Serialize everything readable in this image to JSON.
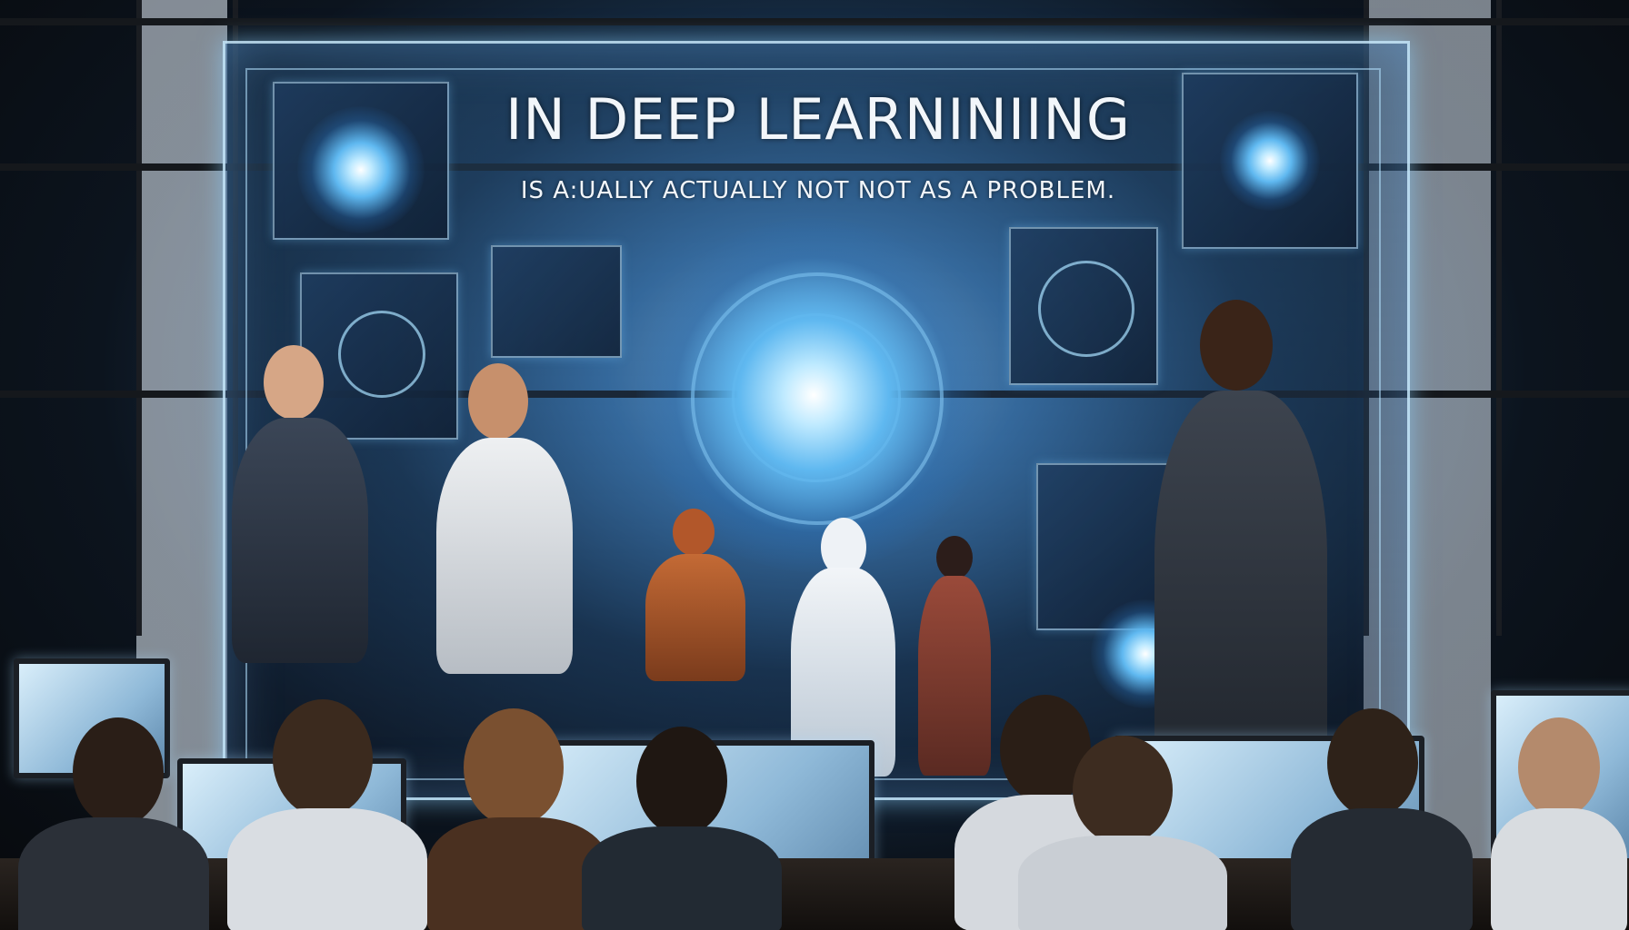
{
  "headline": "IN DEEP LEARNINIING",
  "subline": "IS A:UALLY ACTUALLY NOT NOT AS A PROBLEM.",
  "colors": {
    "glow": "#bfeaff",
    "panel_border": "#c8ebff",
    "background": "#0b1017"
  }
}
